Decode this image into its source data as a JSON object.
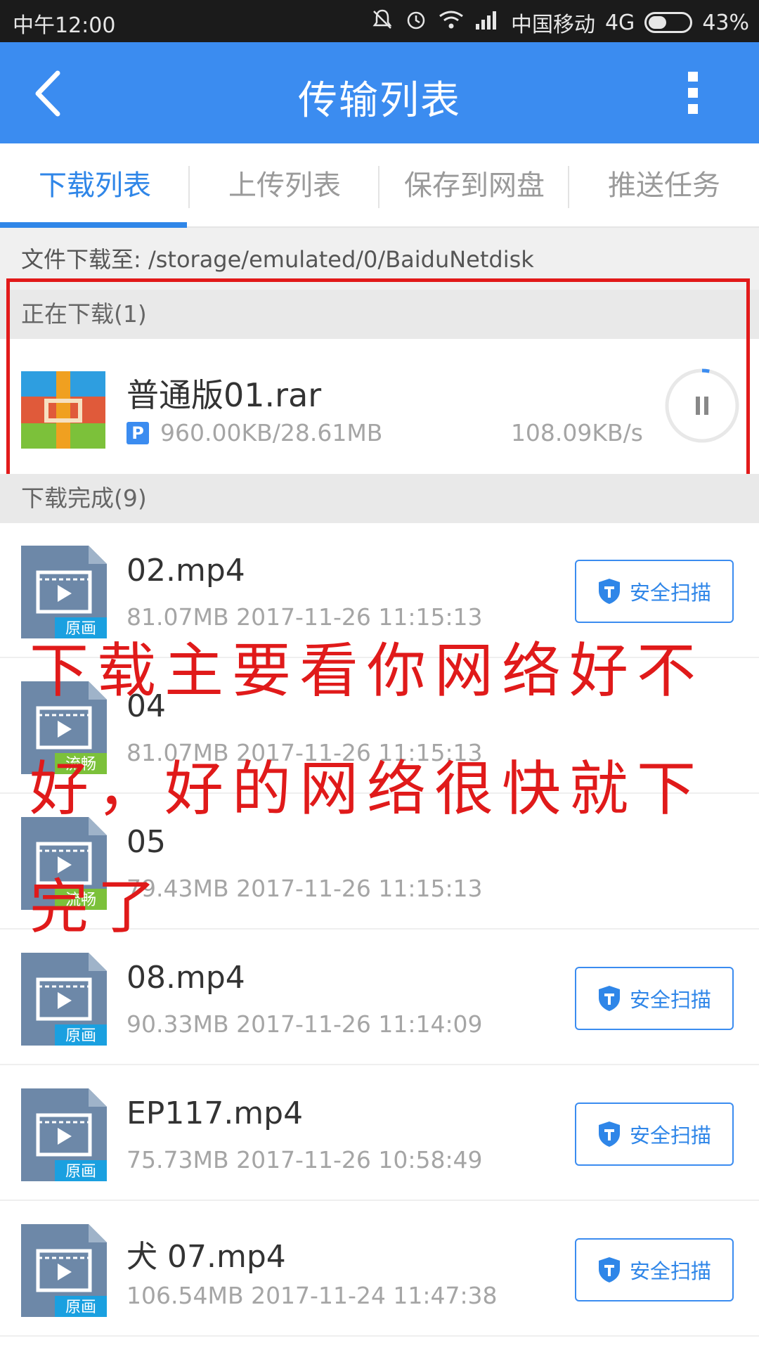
{
  "status_bar": {
    "time": "中午12:00",
    "carrier": "中国移动",
    "network": "4G",
    "battery": "43%"
  },
  "header": {
    "title": "传输列表"
  },
  "tabs": [
    "下载列表",
    "上传列表",
    "保存到网盘",
    "推送任务"
  ],
  "active_tab": "下载列表",
  "download_path": "文件下载至: /storage/emulated/0/BaiduNetdisk",
  "downloading": {
    "header": "正在下载(1)",
    "item": {
      "name": "普通版01.rar",
      "badge": "P",
      "progress": "960.00KB/28.61MB",
      "speed": "108.09KB/s",
      "progress_fraction": 0.033
    }
  },
  "completed": {
    "header": "下载完成(9)",
    "scan_label": "安全扫描",
    "items": [
      {
        "name": "02.mp4",
        "meta": "81.07MB 2017-11-26 11:15:13",
        "tag": "原画",
        "tag_color": "#1aa0e0"
      },
      {
        "name": "04",
        "meta": "81.07MB 2017-11-26 11:15:13",
        "tag": "流畅",
        "tag_color": "#7cc13a"
      },
      {
        "name": "05",
        "meta": "79.43MB 2017-11-26 11:15:13",
        "tag": "流畅",
        "tag_color": "#7cc13a"
      },
      {
        "name": "08.mp4",
        "meta": "90.33MB 2017-11-26 11:14:09",
        "tag": "原画",
        "tag_color": "#1aa0e0"
      },
      {
        "name": "EP117.mp4",
        "meta": "75.73MB 2017-11-26 10:58:49",
        "tag": "原画",
        "tag_color": "#1aa0e0"
      },
      {
        "name": "犬 07.mp4",
        "meta": "106.54MB 2017-11-24 11:47:38",
        "tag": "原画",
        "tag_color": "#1aa0e0"
      }
    ]
  },
  "annotation": {
    "text": "下载主要看你网络好不好，好的网络很快就下完了",
    "color": "#e01a1a"
  },
  "colors": {
    "accent": "#3b8cf0",
    "highlight": "#e21a1a"
  }
}
